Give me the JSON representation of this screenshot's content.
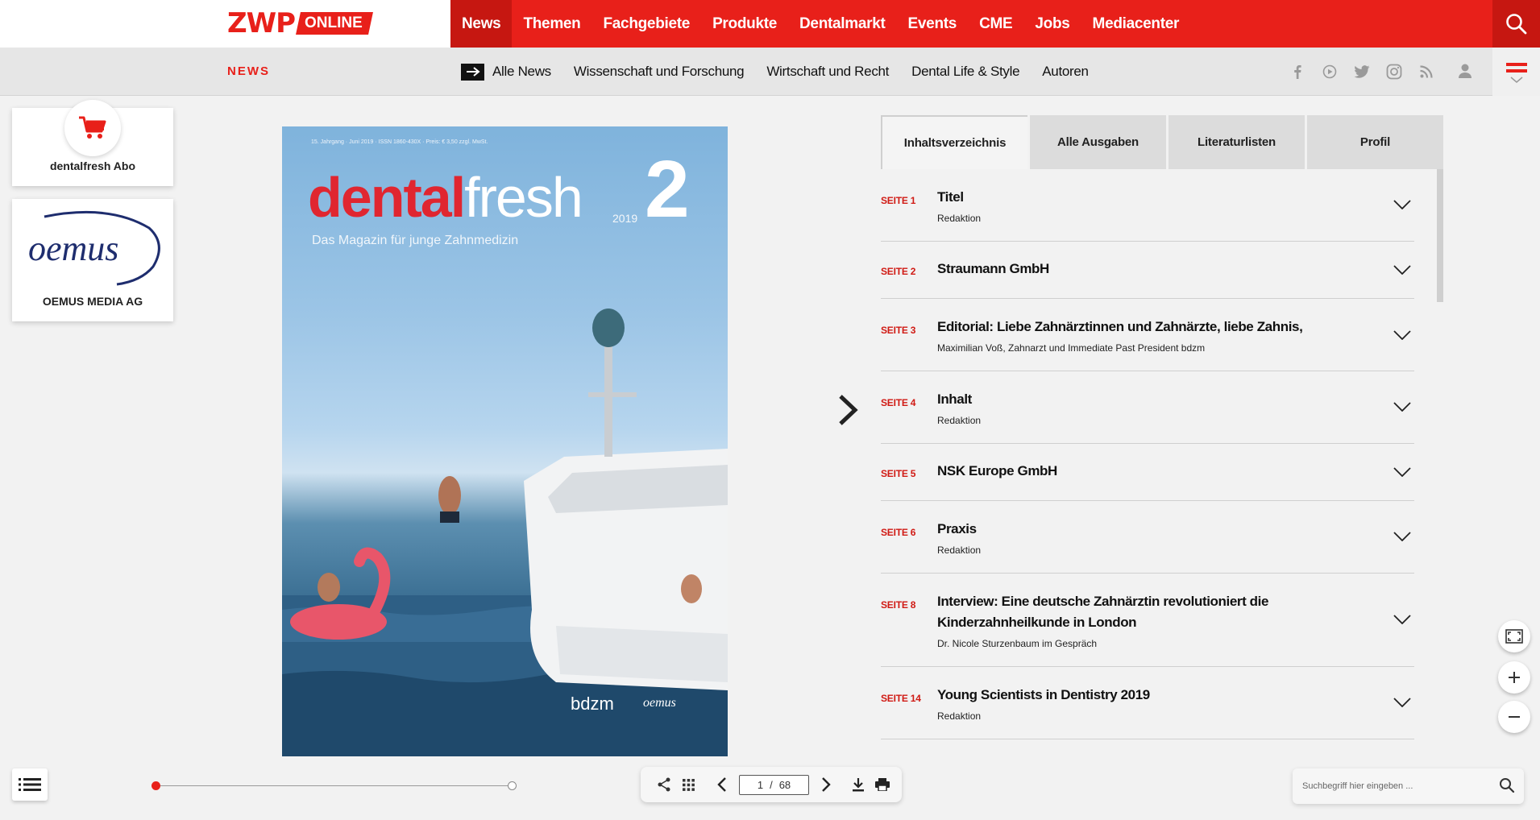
{
  "header": {
    "logo_main": "ZWP",
    "logo_badge": "ONLINE",
    "nav": [
      {
        "label": "News",
        "active": true
      },
      {
        "label": "Themen"
      },
      {
        "label": "Fachgebiete"
      },
      {
        "label": "Produkte"
      },
      {
        "label": "Dentalmarkt"
      },
      {
        "label": "Events"
      },
      {
        "label": "CME"
      },
      {
        "label": "Jobs"
      },
      {
        "label": "Mediacenter"
      }
    ],
    "search_icon": "search-icon",
    "accent_color": "#e8201a"
  },
  "subheader": {
    "section": "NEWS",
    "nav": [
      {
        "label": "Alle News"
      },
      {
        "label": "Wissenschaft und Forschung"
      },
      {
        "label": "Wirtschaft und Recht"
      },
      {
        "label": "Dental Life & Style"
      },
      {
        "label": "Autoren"
      }
    ],
    "socials": [
      "facebook-icon",
      "youtube-icon",
      "twitter-icon",
      "instagram-icon",
      "rss-icon"
    ]
  },
  "sidebar": {
    "cards": [
      {
        "label": "dentalfresh Abo",
        "icon": "cart-icon"
      },
      {
        "label": "OEMUS MEDIA AG",
        "logo_text": "oemus"
      }
    ]
  },
  "magazine": {
    "top_line": "15. Jahrgang · Juni 2019 · ISSN 1860-430X · Preis: € 3,50 zzgl. MwSt.",
    "title_red": "dental",
    "title_white": "fresh",
    "year": "2019",
    "issue": "2",
    "subtitle": "Das Magazin für junge Zahnmedizin",
    "brand1": "bdzm",
    "brand2": "oemus"
  },
  "tabs": [
    {
      "label": "Inhaltsverzeichnis",
      "active": true
    },
    {
      "label": "Alle Ausgaben"
    },
    {
      "label": "Literaturlisten"
    },
    {
      "label": "Profil"
    }
  ],
  "toc": [
    {
      "page": "SEITE 1",
      "title": "Titel",
      "sub": "Redaktion"
    },
    {
      "page": "SEITE 2",
      "title": "Straumann GmbH",
      "sub": ""
    },
    {
      "page": "SEITE 3",
      "title": "Editorial: Liebe Zahnärztinnen und Zahnärzte, liebe Zahnis,",
      "sub": "Maximilian Voß, Zahnarzt und Immediate Past President bdzm"
    },
    {
      "page": "SEITE 4",
      "title": "Inhalt",
      "sub": "Redaktion"
    },
    {
      "page": "SEITE 5",
      "title": "NSK Europe GmbH",
      "sub": ""
    },
    {
      "page": "SEITE 6",
      "title": "Praxis",
      "sub": "Redaktion"
    },
    {
      "page": "SEITE 8",
      "title": "Interview: Eine deutsche Zahnärztin revolutioniert die Kinderzahnheilkunde in London",
      "sub": "Dr. Nicole Sturzenbaum im Gespräch"
    },
    {
      "page": "SEITE 14",
      "title": "Young Scientists in Dentistry 2019",
      "sub": "Redaktion"
    }
  ],
  "pager": {
    "current": "1",
    "separator": "/",
    "total": "68",
    "progress": 0.0
  },
  "search": {
    "placeholder": "Suchbegriff hier eingeben ..."
  }
}
